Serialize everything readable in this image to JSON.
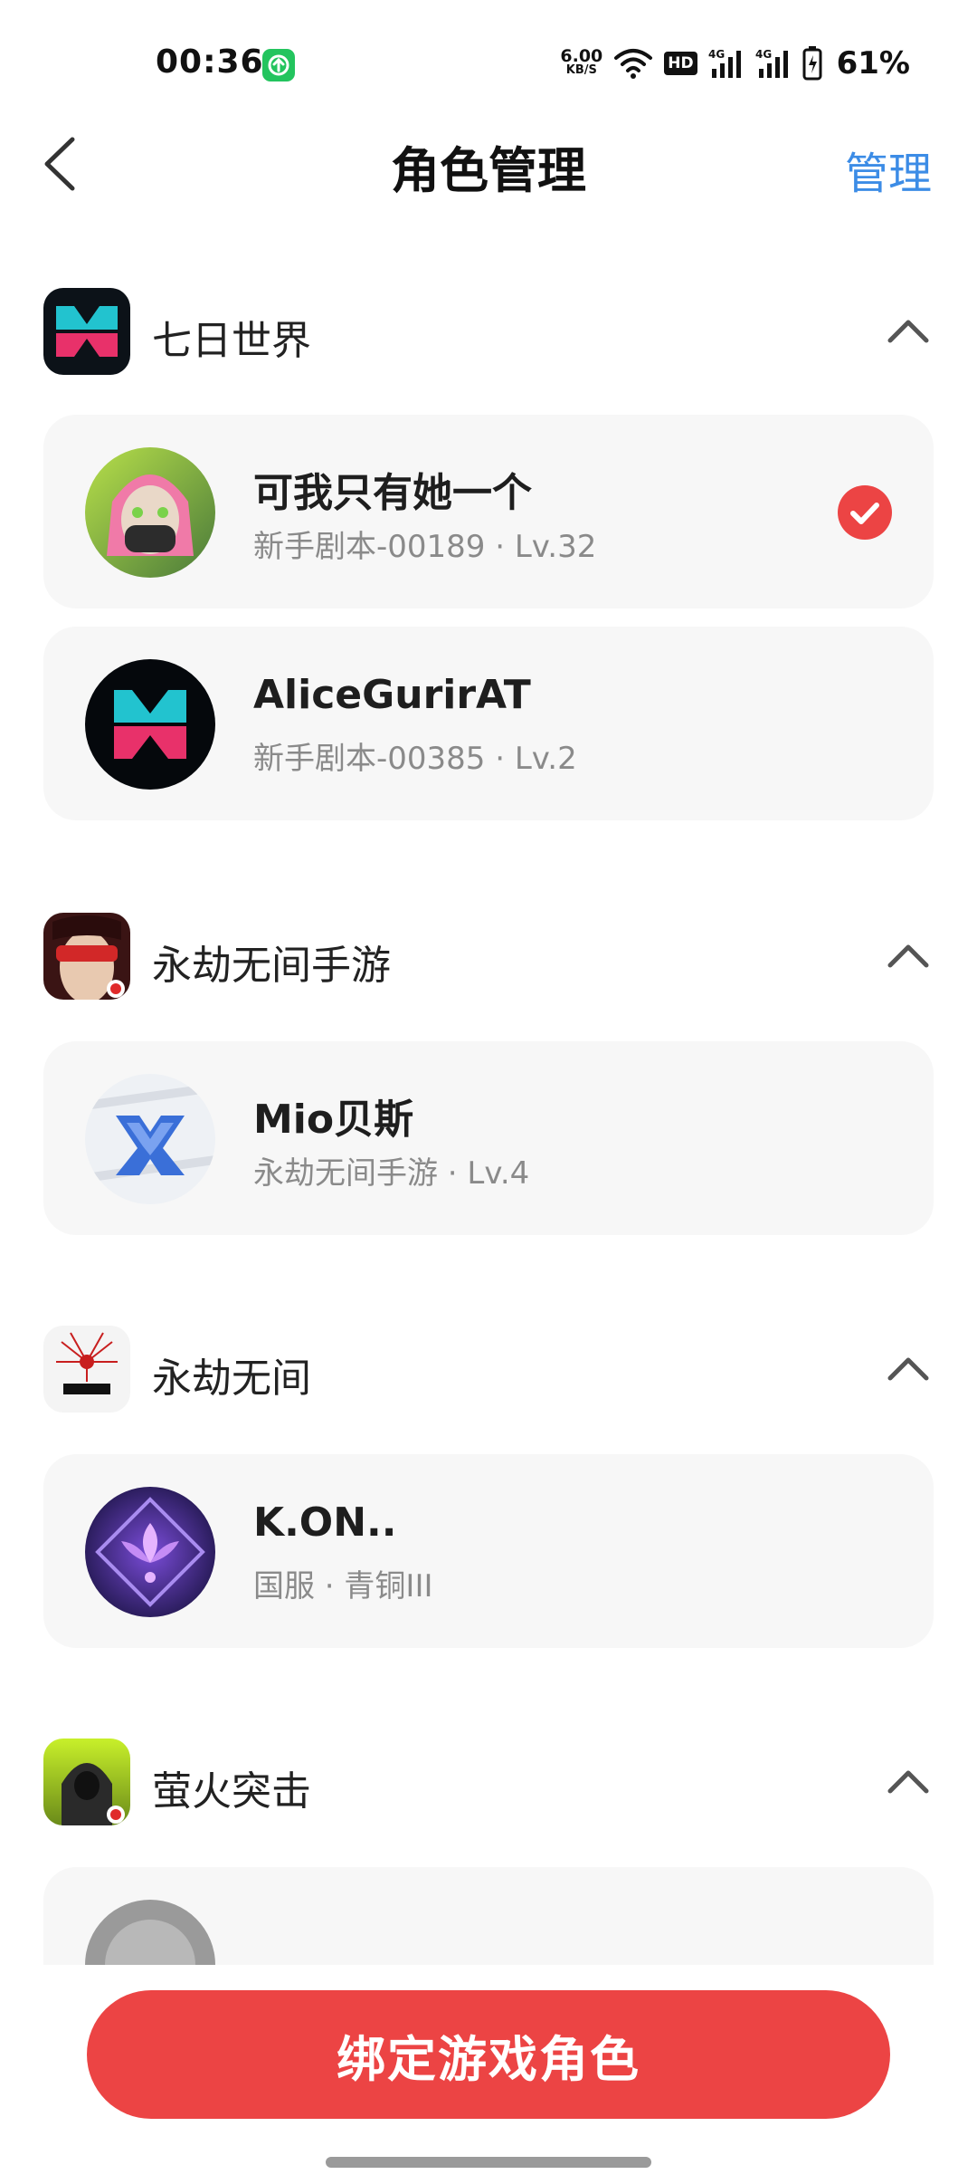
{
  "status_bar": {
    "time": "00:36",
    "net_speed_value": "6.00",
    "net_speed_unit": "KB/S",
    "hd_label": "HD",
    "battery_percent": "61%"
  },
  "nav": {
    "title": "角色管理",
    "manage_label": "管理"
  },
  "games": [
    {
      "name": "七日世界",
      "roles": [
        {
          "name": "可我只有她一个",
          "subtitle": "新手剧本-00189 · Lv.32",
          "selected": true
        },
        {
          "name": "AliceGurirAT",
          "subtitle": "新手剧本-00385 · Lv.2",
          "selected": false
        }
      ]
    },
    {
      "name": "永劫无间手游",
      "roles": [
        {
          "name": "Mio贝斯",
          "subtitle": "永劫无间手游 · Lv.4",
          "selected": false
        }
      ]
    },
    {
      "name": "永劫无间",
      "roles": [
        {
          "name": "K.ON..",
          "subtitle": "国服 · 青铜III",
          "selected": false
        }
      ]
    },
    {
      "name": "萤火突击",
      "roles": []
    }
  ],
  "bind_button_label": "绑定游戏角色",
  "icons": {
    "back": "back-arrow-icon",
    "collapse": "chevron-up-icon",
    "selected": "check-circle-icon"
  },
  "colors": {
    "accent_blue": "#3c8ce6",
    "primary_red": "#ec4444",
    "card_bg": "#f7f7f7"
  }
}
